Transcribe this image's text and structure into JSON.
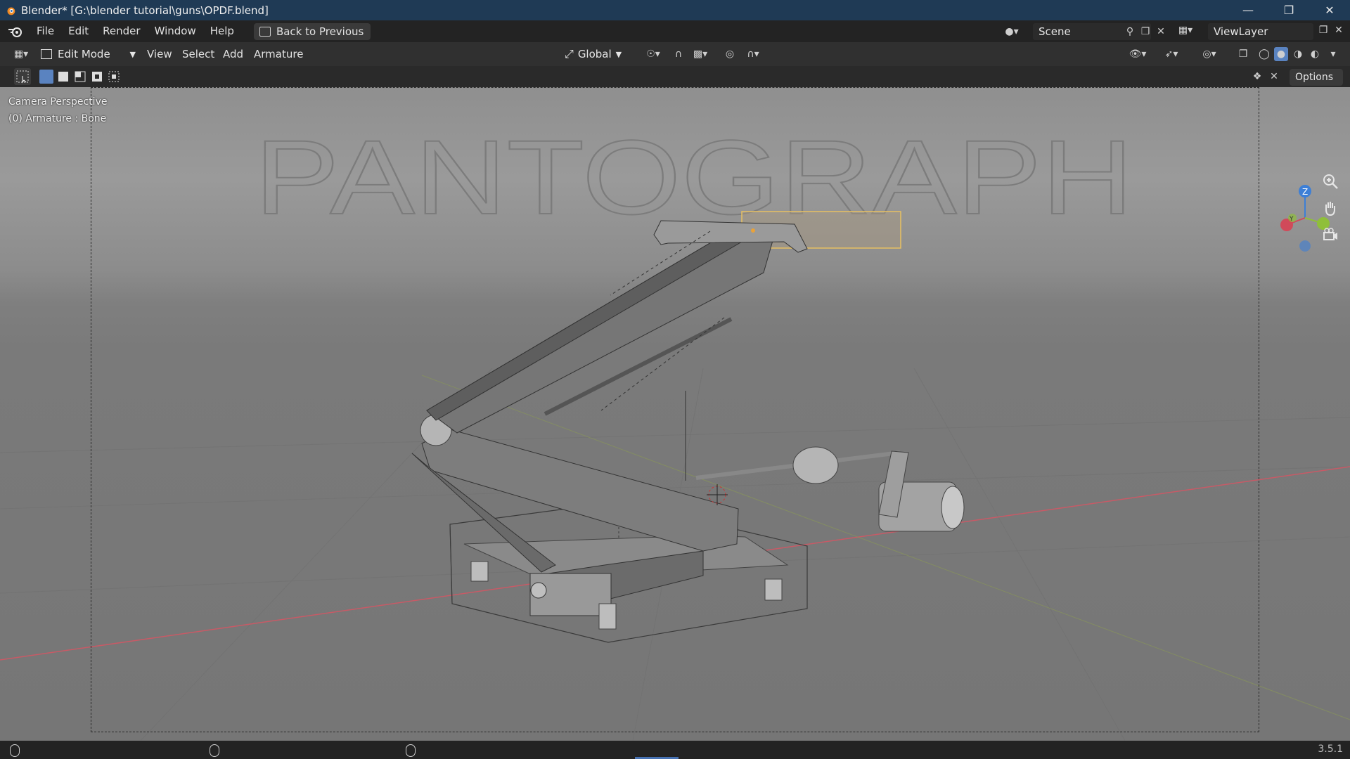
{
  "window": {
    "title": "Blender* [G:\\blender tutorial\\guns\\OPDF.blend]",
    "controls": [
      "minimize",
      "restore",
      "close"
    ]
  },
  "menubar": {
    "items": [
      "File",
      "Edit",
      "Window",
      "Help"
    ],
    "back_button": "Back to Previous",
    "scene": "Scene",
    "view_layer": "ViewLayer"
  },
  "header": {
    "mode": "Edit Mode",
    "menus": [
      "View",
      "Select",
      "Add",
      "Armature"
    ],
    "transform_orientation": "Global"
  },
  "toolrow": {
    "options_label": "Options"
  },
  "viewport": {
    "info_line1": "Camera Perspective",
    "info_line2": "(0) Armature : Bone",
    "background_text": "PANTOGRAPH",
    "gizmo_axes": {
      "z": "Z",
      "y": "Y"
    }
  },
  "statusbar": {
    "version": "3.5.1"
  },
  "colors": {
    "titlebar": "#1f3a55",
    "x_axis": "#d04a5a",
    "y_axis": "#8fbf3a",
    "z_axis": "#3d7fd6",
    "selected_bone": "#e7c062",
    "accent": "#4772b3"
  }
}
